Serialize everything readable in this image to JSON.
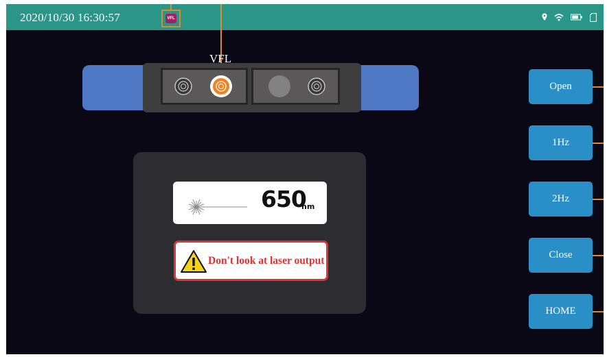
{
  "status_bar": {
    "datetime": "2020/10/30 16:30:57",
    "badge_label": "VFL",
    "icons": [
      "location-icon",
      "wifi-icon",
      "battery-icon",
      "sd-card-icon"
    ]
  },
  "device": {
    "title": "VFL"
  },
  "display": {
    "wavelength_value": "650",
    "wavelength_unit": "nm",
    "warning_text": "Don't look at laser output"
  },
  "buttons": [
    {
      "label": "Open"
    },
    {
      "label": "1Hz"
    },
    {
      "label": "2Hz"
    },
    {
      "label": "Close"
    },
    {
      "label": "HOME"
    }
  ],
  "colors": {
    "status_bar": "#2a9688",
    "background": "#0b0816",
    "button": "#2a8fc7",
    "callout": "#e0892f",
    "laser_port": "#f2821f",
    "warning": "#e03333",
    "device_cap": "#4e78c4"
  }
}
